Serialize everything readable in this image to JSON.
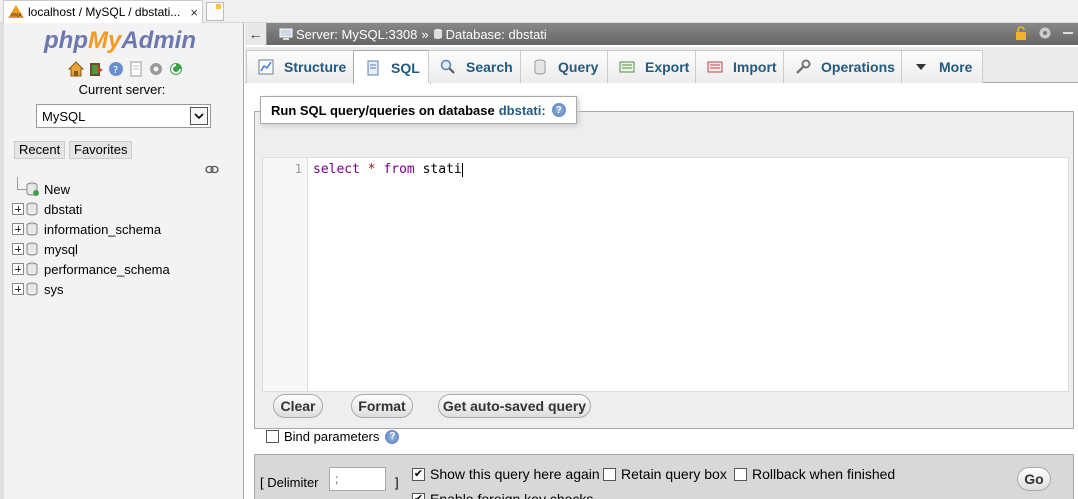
{
  "browser": {
    "tab_title": "localhost / MySQL / dbstati...",
    "tab_close": "×"
  },
  "nav": {
    "logo_php": "php",
    "logo_my": "My",
    "logo_admin": "Admin",
    "icons": [
      "home-icon",
      "exit-icon",
      "help-icon",
      "docs-icon",
      "settings-icon",
      "reload-icon"
    ],
    "current_server_label": "Current server:",
    "server_value": "MySQL",
    "recent_label": "Recent",
    "favorites_label": "Favorites",
    "tree": [
      {
        "label": "New",
        "type": "new"
      },
      {
        "label": "dbstati",
        "type": "db"
      },
      {
        "label": "information_schema",
        "type": "db"
      },
      {
        "label": "mysql",
        "type": "db"
      },
      {
        "label": "performance_schema",
        "type": "db"
      },
      {
        "label": "sys",
        "type": "db"
      }
    ]
  },
  "breadcrumb": {
    "back": "←",
    "server": "Server: MySQL:3308",
    "separator": "»",
    "database": "Database: dbstati"
  },
  "tabs": [
    {
      "label": "Structure",
      "icon": "structure-icon",
      "active": false
    },
    {
      "label": "SQL",
      "icon": "sql-icon",
      "active": true
    },
    {
      "label": "Search",
      "icon": "search-icon",
      "active": false
    },
    {
      "label": "Query",
      "icon": "query-icon",
      "active": false
    },
    {
      "label": "Export",
      "icon": "export-icon",
      "active": false
    },
    {
      "label": "Import",
      "icon": "import-icon",
      "active": false
    },
    {
      "label": "Operations",
      "icon": "wrench-icon",
      "active": false
    },
    {
      "label": "More",
      "icon": "triangle-down-icon",
      "active": false
    }
  ],
  "sql": {
    "legend_prefix": "Run SQL query/queries on database",
    "legend_db": "dbstati:",
    "line_number": "1",
    "code_kw1": "select",
    "code_op": "*",
    "code_kw2": "from",
    "code_ident": "stati",
    "buttons": {
      "clear": "Clear",
      "format": "Format",
      "autosaved": "Get auto-saved query"
    },
    "bind_parameters": "Bind parameters",
    "bind_checked": false
  },
  "options": {
    "delimiter_label": "[ Delimiter",
    "delimiter_value": ";",
    "delimiter_close": "]",
    "show_query_again": "Show this query here again",
    "show_query_checked": true,
    "retain_query_box": "Retain query box",
    "retain_checked": false,
    "rollback": "Rollback when finished",
    "rollback_checked": false,
    "foreign_keys": "Enable foreign key checks",
    "foreign_checked": true,
    "go": "Go"
  }
}
